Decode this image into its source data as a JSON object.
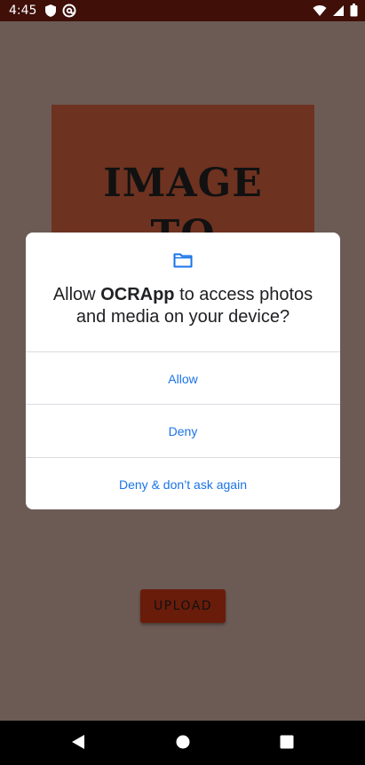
{
  "status_bar": {
    "time": "4:45",
    "left_icons": [
      "shield-icon",
      "at-sign-icon"
    ],
    "right_icons": [
      "wifi-icon",
      "signal-icon",
      "battery-icon"
    ]
  },
  "app": {
    "image_text_line1": "IMAGE",
    "image_text_line2": "TO",
    "upload_label": "UPLOAD",
    "colors": {
      "image_bg": "#6e3220",
      "button_bg": "#6a1c0a"
    }
  },
  "dialog": {
    "icon": "folder-icon",
    "message_prefix": "Allow ",
    "app_name": "OCRApp",
    "message_suffix": " to access photos and media on your device?",
    "allow": "Allow",
    "deny": "Deny",
    "deny_dont_ask": "Deny & don’t ask again",
    "colors": {
      "accent": "#1a73e8"
    }
  },
  "nav_bar": {
    "buttons": [
      "back-icon",
      "home-icon",
      "recents-icon"
    ]
  }
}
